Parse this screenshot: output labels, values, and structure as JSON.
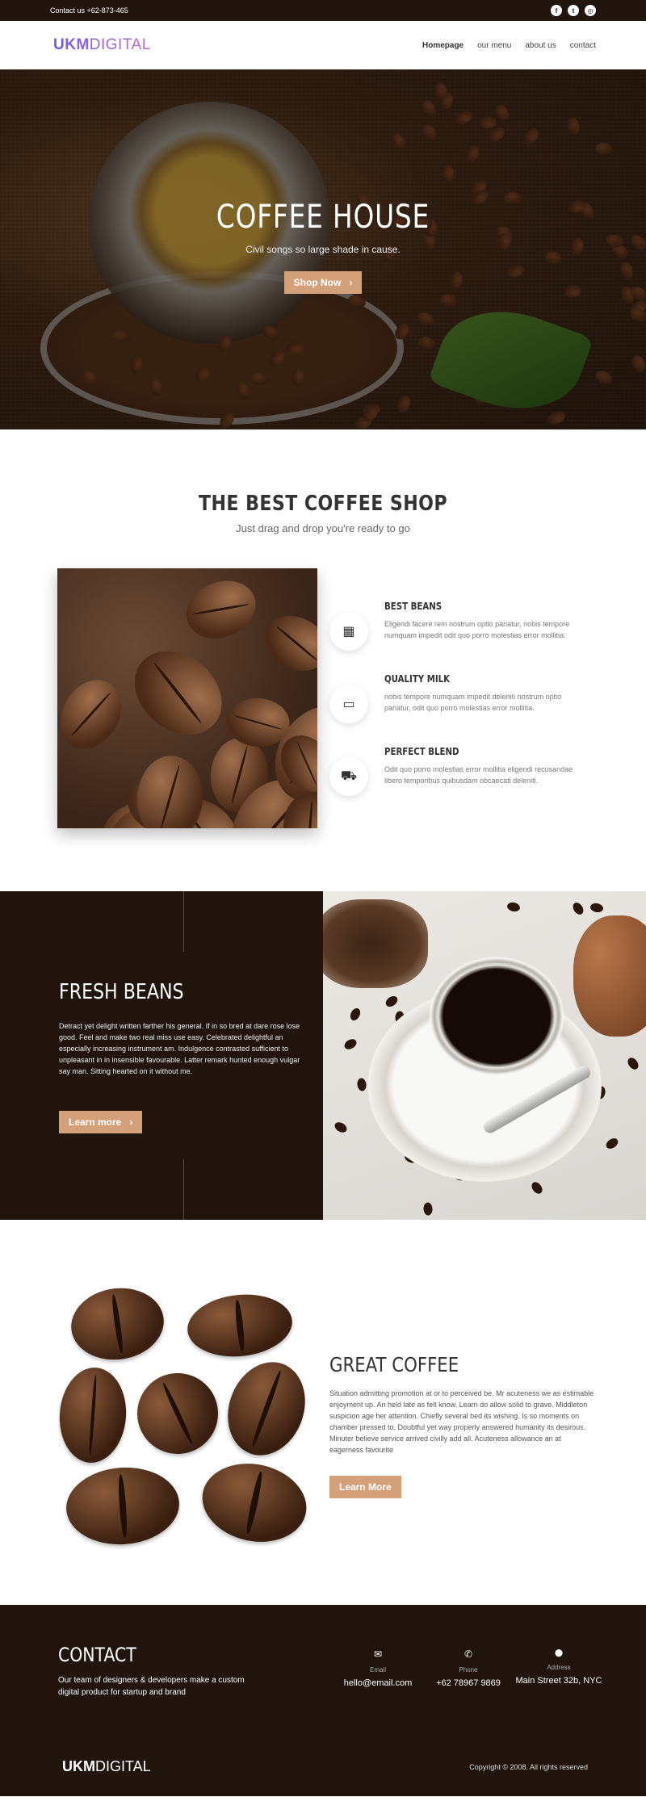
{
  "topbar": {
    "contact": "Contact us +62-873-465",
    "socials": [
      {
        "icon": "facebook-icon",
        "glyph": "f"
      },
      {
        "icon": "twitter-icon",
        "glyph": "t"
      },
      {
        "icon": "instagram-icon",
        "glyph": "◎"
      }
    ]
  },
  "brand": {
    "logo_bold": "UKM",
    "logo_light": "DIGITAL",
    "gradient": [
      "#6e5be8",
      "#c06ad8"
    ]
  },
  "nav": {
    "items": [
      {
        "label": "Homepage",
        "active": true
      },
      {
        "label": "our menu",
        "active": false
      },
      {
        "label": "about us",
        "active": false
      },
      {
        "label": "contact",
        "active": false
      }
    ]
  },
  "hero": {
    "title": "COFFEE HOUSE",
    "subtitle": "Civil songs so large shade in cause.",
    "button": "Shop Now",
    "button_icon": "›"
  },
  "best": {
    "title": "THE BEST COFFEE SHOP",
    "subtitle": "Just drag and drop you're ready to go",
    "features": [
      {
        "icon": "grid-icon",
        "glyph": "▦",
        "title": "BEST BEANS",
        "text": "Eligendi facere rem nostrum optio pariatur, nobis tempore numquam impedit odit quo porro molestias error mollitia."
      },
      {
        "icon": "monitor-icon",
        "glyph": "▭",
        "title": "QUALITY MILK",
        "text": "nobis tempore numquam impedit deleniti nostrum optio pariatur, odit quo porro molestias error mollitia."
      },
      {
        "icon": "truck-icon",
        "glyph": "⛟",
        "title": "PERFECT BLEND",
        "text": "Odit quo porro molestias error mollitia eligendi recusandae libero temporibus quibusdam obcaecati deleniti."
      }
    ]
  },
  "fresh": {
    "title": "FRESH BEANS",
    "text": "Detract yet delight written farther his general. If in so bred at dare rose lose good. Feel and make two real miss use easy. Celebrated delightful an especially increasing instrument am. Indulgence contrasted sufficient to unpleasant in in insensible favourable. Latter remark hunted enough vulgar say man. Sitting hearted on it without me.",
    "button": "Learn more",
    "button_icon": "›"
  },
  "great": {
    "title": "GREAT COFFEE",
    "text": "Situation admitting promotion at or to perceived be. Mr acuteness we as estimable enjoyment up. An held late as felt know. Learn do allow solid to grave. Middleton suspicion age her attention. Chiefly several bed its wishing. Is so moments on chamber pressed to. Doubtful yet way properly answered humanity its desirous. Minuter believe service arrived civilly add all. Acuteness allowance an at eagerness favourite",
    "button": "Learn More"
  },
  "contact": {
    "title": "CONTACT",
    "text": "Our team of designers & developers make a custom digital product for startup and brand",
    "items": [
      {
        "icon": "envelope-icon",
        "glyph": "✉",
        "label": "Email",
        "value": "hello@email.com"
      },
      {
        "icon": "phone-icon",
        "glyph": "✆",
        "label": "Phone",
        "value": "+62 78967 9869"
      },
      {
        "icon": "map-pin-icon",
        "glyph": "⬤",
        "label": "Address",
        "value": "Main Street 32b, NYC"
      }
    ],
    "copyright": "Copyright © 2008. All rights reserved"
  },
  "colors": {
    "dark": "#21140c",
    "accent": "#d4a07a"
  }
}
